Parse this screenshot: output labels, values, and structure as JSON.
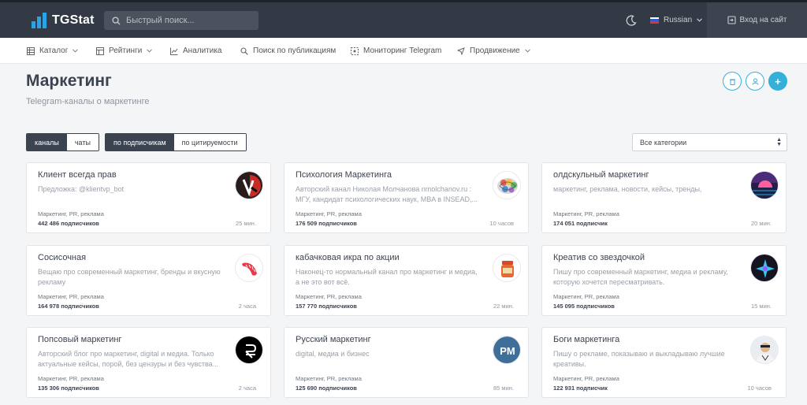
{
  "header": {
    "logo_text": "TGStat",
    "search_placeholder": "Быстрый поиск...",
    "language": "Russian",
    "login_label": "Вход на сайт"
  },
  "nav": {
    "items": [
      {
        "label": "Каталог",
        "icon": "catalog-icon",
        "dropdown": true
      },
      {
        "label": "Рейтинги",
        "icon": "ratings-icon",
        "dropdown": true
      },
      {
        "label": "Аналитика",
        "icon": "analytics-icon",
        "dropdown": false
      },
      {
        "label": "Поиск по публикациям",
        "icon": "search-icon",
        "dropdown": false
      },
      {
        "label": "Мониторинг Telegram",
        "icon": "monitor-icon",
        "dropdown": false
      },
      {
        "label": "Продвижение",
        "icon": "promo-icon",
        "dropdown": true
      }
    ]
  },
  "page": {
    "title": "Маркетинг",
    "subtitle": "Telegram-каналы о маркетинге"
  },
  "filters": {
    "type": {
      "channels": "каналы",
      "chats": "чаты"
    },
    "sort": {
      "by_subscribers": "по подписчикам",
      "by_citation": "по цитируемости"
    },
    "category": "Все категории"
  },
  "colors": {
    "accent": "#35b0d8",
    "dark": "#343a45",
    "logo_blue": "#2aa3e6"
  },
  "cards": [
    {
      "title": "Клиент всегда прав",
      "desc": "Предложка: @klientvp_bot",
      "category": "Маркетинг, PR, реклама",
      "subs_num": "442 486",
      "subs_word": "подписчиков",
      "time": "25 мин."
    },
    {
      "title": "Психология Маркетинга",
      "desc": "Авторский канал Николая Молчанова nmolchanov.ru : МГУ, кандидат психологических наук, MBA в INSEAD,...",
      "category": "Маркетинг, PR, реклама",
      "subs_num": "176 509",
      "subs_word": "подписчиков",
      "time": "10 часов"
    },
    {
      "title": "олдскульный маркетинг",
      "desc": "маркетинг, реклама, новости, кейсы, тренды,",
      "category": "Маркетинг, PR, реклама",
      "subs_num": "174 051",
      "subs_word": "подписчик",
      "time": "20 мин."
    },
    {
      "title": "Сосисочная",
      "desc": "Вещаю про современный маркетинг, бренды и вкусную рекламу",
      "category": "Маркетинг, PR, реклама",
      "subs_num": "164 978",
      "subs_word": "подписчиков",
      "time": "2 часа"
    },
    {
      "title": "кабачковая икра по акции",
      "desc": "Наконец-то нормальный канал про маркетинг и медиа, а не это вот всё.",
      "category": "Маркетинг, PR, реклама",
      "subs_num": "157 770",
      "subs_word": "подписчиков",
      "time": "22 мин."
    },
    {
      "title": "Креатив со звездочкой",
      "desc": "Пишу про современный маркетинг, медиа и рекламу, которую хочется пересматривать.",
      "category": "Маркетинг, PR, реклама",
      "subs_num": "145 095",
      "subs_word": "подписчиков",
      "time": "15 мин."
    },
    {
      "title": "Попсовый маркетинг",
      "desc": "Авторский блог про маркетинг, digital и медиа. Только актуальные кейсы, порой, без цензуры и без чувства...",
      "category": "Маркетинг, PR, реклама",
      "subs_num": "135 306",
      "subs_word": "подписчиков",
      "time": "2 часа"
    },
    {
      "title": "Русский маркетинг",
      "desc": "digital, медиа и бизнес",
      "category": "Маркетинг, PR, реклама",
      "subs_num": "125 690",
      "subs_word": "подписчиков",
      "time": "85 мин."
    },
    {
      "title": "Боги маркетинга",
      "desc": "Пишу о рекламе, показываю и выкладываю лучшие креативы.",
      "category": "Маркетинг, PR, реклама",
      "subs_num": "122 931",
      "subs_word": "подписчик",
      "time": "10 часов"
    }
  ],
  "avatars": {
    "rm_text": "PM"
  }
}
